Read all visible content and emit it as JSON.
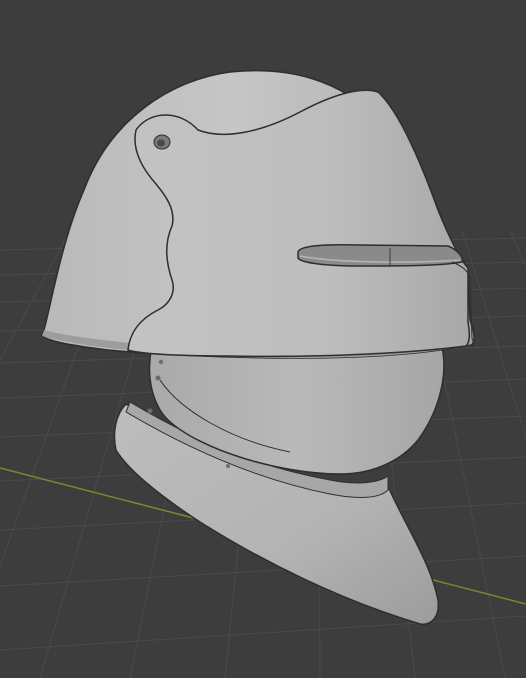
{
  "viewport": {
    "background": "#3d3d3d",
    "grid_line_color": "#4a4a4a",
    "x_axis_color": "#6f8f2c",
    "model_color": "#b4b4b4",
    "model_highlight": "#c8c8c8",
    "model_shadow": "#8e8e8e",
    "edge_color": "#2e2e2e",
    "model_name": ""
  }
}
